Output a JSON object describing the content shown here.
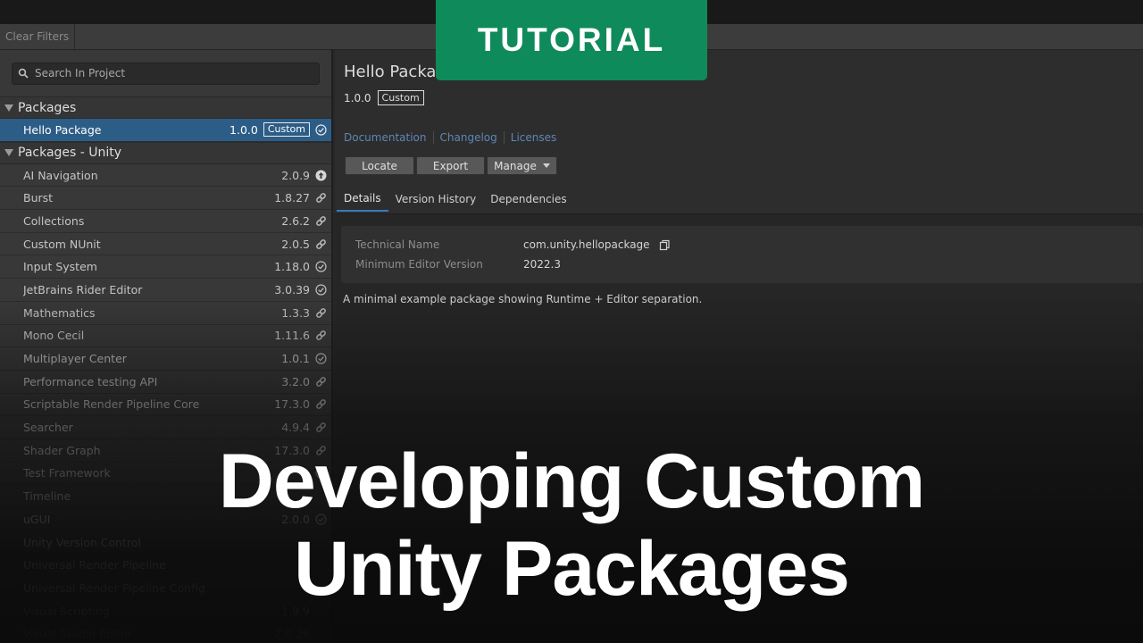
{
  "toolbar": {
    "clear_filters": "Clear Filters"
  },
  "search": {
    "placeholder": "Search In Project"
  },
  "groups": [
    {
      "title": "Packages"
    },
    {
      "title": "Packages - Unity"
    }
  ],
  "selected_package": {
    "name": "Hello Package",
    "version": "1.0.0",
    "badge": "Custom",
    "status": "installed-check-icon"
  },
  "unity_packages": [
    {
      "name": "AI Navigation",
      "version": "2.0.9",
      "status": "update-arrow-icon"
    },
    {
      "name": "Burst",
      "version": "1.8.27",
      "status": "link-icon"
    },
    {
      "name": "Collections",
      "version": "2.6.2",
      "status": "link-icon"
    },
    {
      "name": "Custom NUnit",
      "version": "2.0.5",
      "status": "link-icon"
    },
    {
      "name": "Input System",
      "version": "1.18.0",
      "status": "installed-check-icon"
    },
    {
      "name": "JetBrains Rider Editor",
      "version": "3.0.39",
      "status": "installed-check-icon"
    },
    {
      "name": "Mathematics",
      "version": "1.3.3",
      "status": "link-icon"
    },
    {
      "name": "Mono Cecil",
      "version": "1.11.6",
      "status": "link-icon"
    },
    {
      "name": "Multiplayer Center",
      "version": "1.0.1",
      "status": "installed-check-icon"
    },
    {
      "name": "Performance testing API",
      "version": "3.2.0",
      "status": "link-icon"
    },
    {
      "name": "Scriptable Render Pipeline Core",
      "version": "17.3.0",
      "status": "link-icon"
    },
    {
      "name": "Searcher",
      "version": "4.9.4",
      "status": "link-icon"
    },
    {
      "name": "Shader Graph",
      "version": "17.3.0",
      "status": "link-icon"
    },
    {
      "name": "Test Framework",
      "version": "",
      "status": "installed-check-icon"
    },
    {
      "name": "Timeline",
      "version": "",
      "status": ""
    },
    {
      "name": "uGUI",
      "version": "2.0.0",
      "status": "installed-check-icon"
    },
    {
      "name": "Unity Version Control",
      "version": "",
      "status": ""
    },
    {
      "name": "Universal Render Pipeline",
      "version": "",
      "status": ""
    },
    {
      "name": "Universal Render Pipeline Config",
      "version": "",
      "status": ""
    },
    {
      "name": "Visual Scripting",
      "version": "1.9.9",
      "status": ""
    },
    {
      "name": "Visual Studio Editor",
      "version": "2.0.26",
      "status": ""
    }
  ],
  "detail": {
    "title": "Hello Package",
    "version": "1.0.0",
    "badge": "Custom",
    "links": [
      "Documentation",
      "Changelog",
      "Licenses"
    ],
    "buttons": {
      "locate": "Locate",
      "export": "Export",
      "manage": "Manage"
    },
    "tabs": [
      "Details",
      "Version History",
      "Dependencies"
    ],
    "active_tab": "Details",
    "info": [
      {
        "key": "Technical Name",
        "value": "com.unity.hellopackage"
      },
      {
        "key": "Minimum Editor Version",
        "value": "2022.3"
      }
    ],
    "description": "A minimal example package showing Runtime + Editor separation."
  },
  "overlay": {
    "badge": "TUTORIAL",
    "headline_line1": "Developing Custom",
    "headline_line2": "Unity Packages"
  },
  "colors": {
    "selection": "#2c5d87",
    "tutorial_green": "#0f8a5a",
    "link": "#5e86b4",
    "tab_underline": "#3a79bb"
  }
}
